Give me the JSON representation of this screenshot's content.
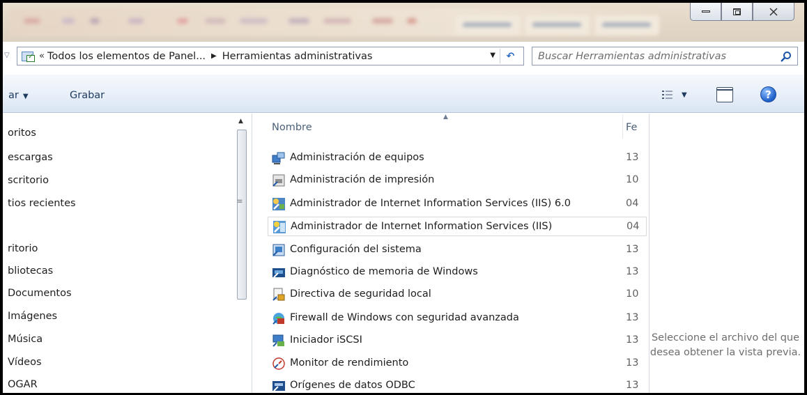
{
  "window": {
    "controls": {
      "minimize": "minimize",
      "maximize": "maximize",
      "close": "close"
    }
  },
  "address": {
    "overflow": "«",
    "crumbs": [
      "Todos los elementos de Panel...",
      "Herramientas administrativas"
    ]
  },
  "search": {
    "placeholder": "Buscar Herramientas administrativas"
  },
  "command_bar": {
    "organize_label": "ar",
    "burn_label": "Grabar"
  },
  "nav": {
    "items": [
      "oritos",
      "escargas",
      "scritorio",
      "tios recientes",
      "ritorio",
      "bliotecas",
      "Documentos",
      "Imágenes",
      "Música",
      "Vídeos",
      "OGAR"
    ]
  },
  "columns": {
    "name": "Nombre",
    "date": "Fe"
  },
  "files": [
    {
      "name": "Administración de equipos",
      "date": "13",
      "icon": "computer-management-icon"
    },
    {
      "name": "Administración de impresión",
      "date": "10",
      "icon": "print-management-icon"
    },
    {
      "name": "Administrador de Internet Information Services (IIS) 6.0",
      "date": "04",
      "icon": "iis6-manager-icon"
    },
    {
      "name": "Administrador de Internet Information Services (IIS)",
      "date": "04",
      "icon": "iis-manager-icon",
      "selected": true
    },
    {
      "name": "Configuración del sistema",
      "date": "13",
      "icon": "system-configuration-icon"
    },
    {
      "name": "Diagnóstico de memoria de Windows",
      "date": "13",
      "icon": "memory-diagnostic-icon"
    },
    {
      "name": "Directiva de seguridad local",
      "date": "10",
      "icon": "local-security-policy-icon"
    },
    {
      "name": "Firewall de Windows con seguridad avanzada",
      "date": "13",
      "icon": "firewall-icon"
    },
    {
      "name": "Iniciador iSCSI",
      "date": "13",
      "icon": "iscsi-initiator-icon"
    },
    {
      "name": "Monitor de rendimiento",
      "date": "13",
      "icon": "performance-monitor-icon"
    },
    {
      "name": "Orígenes de datos ODBC",
      "date": "13",
      "icon": "odbc-data-sources-icon"
    }
  ],
  "preview": {
    "message": "Seleccione el archivo del que desea obtener la vista previa."
  }
}
